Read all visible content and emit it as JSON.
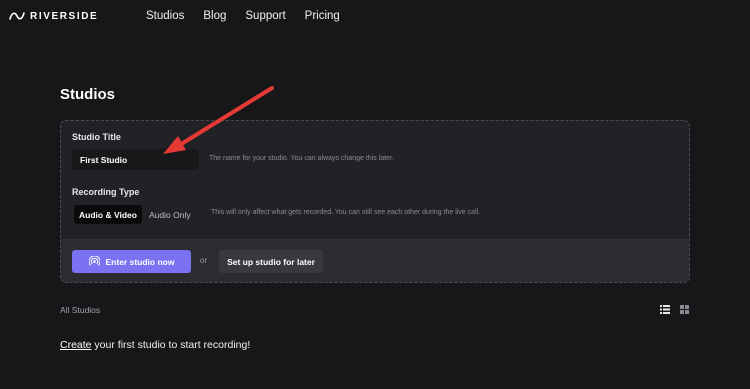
{
  "header": {
    "logo_text": "RIVERSIDE",
    "nav": [
      "Studios",
      "Blog",
      "Support",
      "Pricing"
    ]
  },
  "page": {
    "title": "Studios"
  },
  "form": {
    "studio_title_label": "Studio Title",
    "studio_title_value": "First Studio",
    "studio_title_hint": "The name for your studio. You can always change this later.",
    "recording_type_label": "Recording Type",
    "recording_options": [
      "Audio & Video",
      "Audio Only"
    ],
    "selected_recording_option": "Audio & Video",
    "recording_type_hint": "This will only affect what gets recorded. You can still see each other during the live call."
  },
  "actions": {
    "enter_studio_label": "Enter studio now",
    "or_text": "or",
    "setup_later_label": "Set up studio for later"
  },
  "studios_list": {
    "heading": "All Studios",
    "empty_link_text": "Create",
    "empty_rest_text": " your first studio to start recording!"
  },
  "colors": {
    "background": "#171719",
    "card": "#222226",
    "primary": "#7a72f0",
    "annotation_arrow": "#e53935"
  },
  "icons": [
    "riverside-logo-icon",
    "broadcast-icon",
    "list-view-icon",
    "grid-view-icon",
    "red-annotation-arrow"
  ]
}
